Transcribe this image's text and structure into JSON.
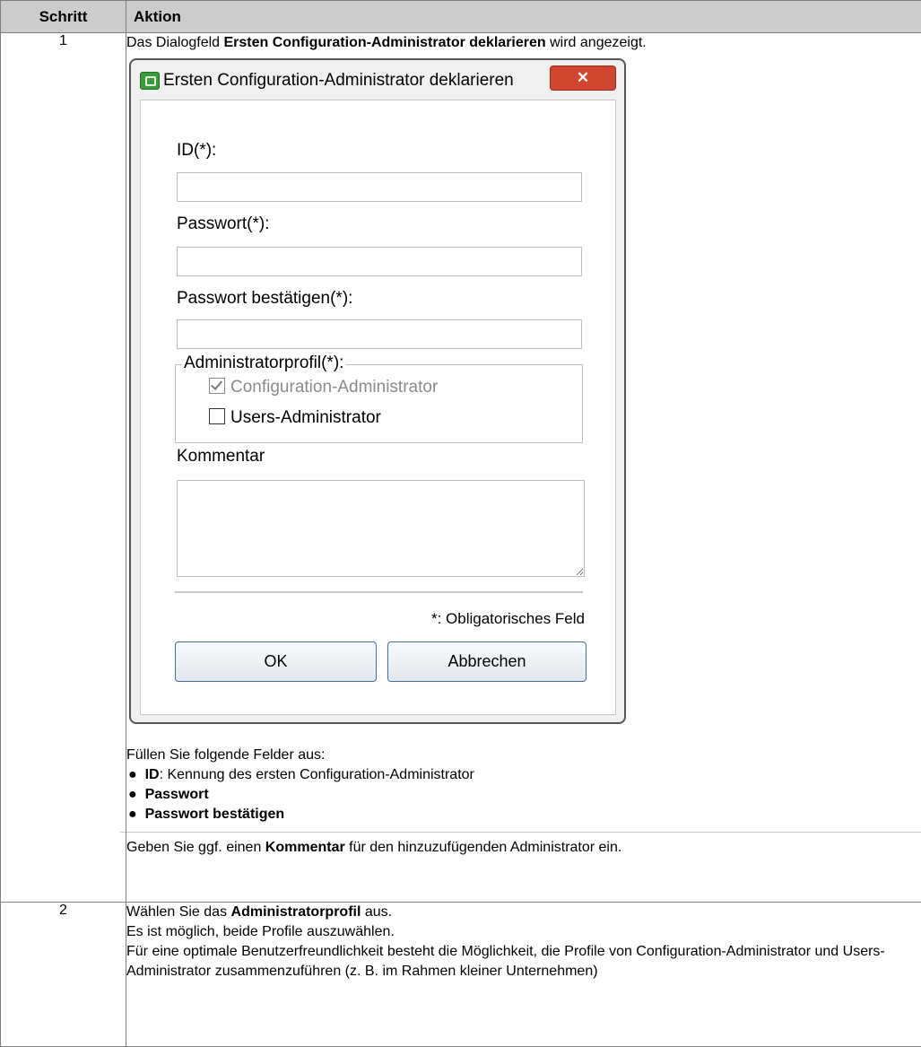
{
  "table": {
    "headers": {
      "step": "Schritt",
      "action": "Aktion"
    },
    "rows": [
      {
        "step": "1",
        "intro": {
          "before": "Das Dialogfeld ",
          "bold": "Ersten Configuration-Administrator deklarieren",
          "after": " wird angezeigt."
        },
        "fill_text": "Füllen Sie folgende Felder aus:",
        "bullets": [
          {
            "bold": "ID",
            "text": ": Kennung des ersten Configuration-Administrator"
          },
          {
            "bold": "Passwort",
            "text": ""
          },
          {
            "bold": "Passwort bestätigen",
            "text": ""
          }
        ],
        "comment_note": {
          "before": "Geben Sie ggf. einen ",
          "bold": "Kommentar",
          "after": " für den hinzuzufügenden Administrator ein."
        }
      },
      {
        "step": "2",
        "line1": {
          "before": "Wählen Sie das ",
          "bold": "Administratorprofil",
          "after": " aus."
        },
        "line2": "Es ist möglich, beide Profile auszuwählen.",
        "line3": "Für eine optimale Benutzerfreundlichkeit besteht die Möglichkeit, die Profile von Configuration-Administrator und Users-Administrator zusammenzuführen (z. B. im Rahmen kleiner Unternehmen)"
      }
    ]
  },
  "dialog": {
    "title": "Ersten Configuration-Administrator deklarieren",
    "close_label": "✕",
    "id_label": "ID(*):",
    "id_value": "",
    "password_label": "Passwort(*):",
    "password_value": "",
    "confirm_label": "Passwort bestätigen(*):",
    "confirm_value": "",
    "profile_legend": "Administratorprofil(*):",
    "profile_options": [
      {
        "label": "Configuration-Administrator",
        "checked": true,
        "enabled": false
      },
      {
        "label": "Users-Administrator",
        "checked": false,
        "enabled": true
      }
    ],
    "comment_label": "Kommentar",
    "comment_value": "",
    "required_note": "*: Obligatorisches Feld",
    "ok_label": "OK",
    "cancel_label": "Abbrechen"
  }
}
